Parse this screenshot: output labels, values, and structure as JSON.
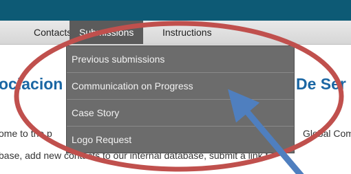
{
  "nav": {
    "contacts_label": "Contacts",
    "submissions_label": "Submissions",
    "instructions_label": "Instructions"
  },
  "dropdown": {
    "items": [
      {
        "label": "Previous submissions"
      },
      {
        "label": "Communication on Progress"
      },
      {
        "label": "Case Story"
      },
      {
        "label": "Logo Request"
      }
    ]
  },
  "page": {
    "heading_left": "ociacion",
    "heading_right": "De Ser",
    "intro_line1_left": "ome to the p",
    "intro_line1_right": "Global Com",
    "intro_line2": "base, add new contacts to our internal database, submit a link t"
  },
  "annotation": {
    "ellipse_color": "#c0504d",
    "arrow_color": "#4f7fbf"
  }
}
